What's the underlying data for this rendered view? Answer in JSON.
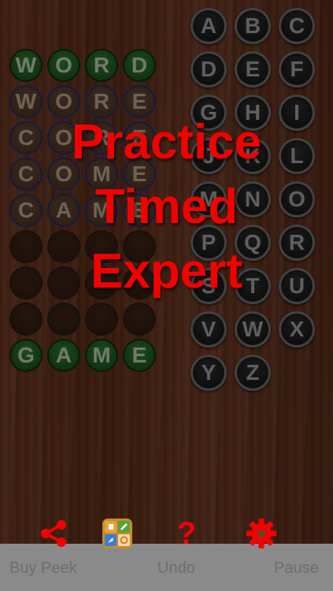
{
  "overlay": {
    "modes": [
      "Practice",
      "Timed",
      "Expert"
    ]
  },
  "keypad": {
    "letters": [
      "A",
      "B",
      "C",
      "D",
      "E",
      "F",
      "G",
      "H",
      "I",
      "J",
      "K",
      "L",
      "M",
      "N",
      "O",
      "P",
      "Q",
      "R",
      "S",
      "T",
      "U",
      "V",
      "W",
      "X",
      "Y",
      "Z"
    ]
  },
  "grid": {
    "rows": [
      {
        "style": "green",
        "letters": [
          "W",
          "O",
          "R",
          "D"
        ]
      },
      {
        "style": "tan",
        "letters": [
          "W",
          "O",
          "R",
          "E"
        ]
      },
      {
        "style": "tan",
        "letters": [
          "C",
          "O",
          "R",
          "E"
        ]
      },
      {
        "style": "tan",
        "letters": [
          "C",
          "O",
          "M",
          "E"
        ]
      },
      {
        "style": "tan",
        "letters": [
          "C",
          "A",
          "M",
          "E"
        ]
      },
      {
        "style": "empty",
        "letters": [
          "",
          "",
          "",
          ""
        ]
      },
      {
        "style": "empty",
        "letters": [
          "",
          "",
          "",
          ""
        ]
      },
      {
        "style": "empty",
        "letters": [
          "",
          "",
          "",
          ""
        ]
      },
      {
        "style": "green",
        "letters": [
          "G",
          "A",
          "M",
          "E"
        ]
      }
    ]
  },
  "toolbar": {
    "buy_peek": "Buy Peek",
    "undo": "Undo",
    "pause": "Pause"
  },
  "icons": [
    "share-icon",
    "more-apps-icon",
    "help-icon",
    "settings-icon"
  ],
  "colors": {
    "accent": "#f20000",
    "tile_green": "#2f7a2f",
    "tile_tan": "#5c4431",
    "key_dark": "#1a1a1a"
  }
}
